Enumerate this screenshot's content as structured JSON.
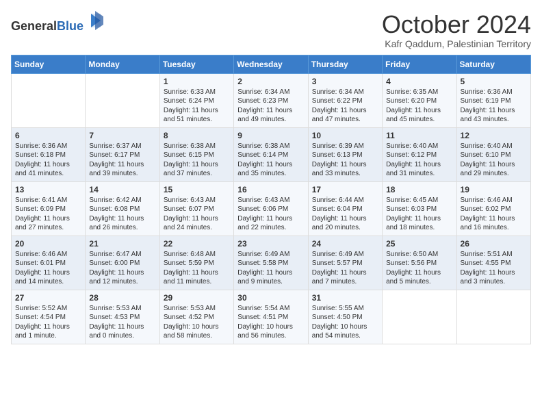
{
  "header": {
    "logo_general": "General",
    "logo_blue": "Blue",
    "month_title": "October 2024",
    "subtitle": "Kafr Qaddum, Palestinian Territory"
  },
  "days_of_week": [
    "Sunday",
    "Monday",
    "Tuesday",
    "Wednesday",
    "Thursday",
    "Friday",
    "Saturday"
  ],
  "weeks": [
    [
      {
        "day": "",
        "sunrise": "",
        "sunset": "",
        "daylight": ""
      },
      {
        "day": "",
        "sunrise": "",
        "sunset": "",
        "daylight": ""
      },
      {
        "day": "1",
        "sunrise": "Sunrise: 6:33 AM",
        "sunset": "Sunset: 6:24 PM",
        "daylight": "Daylight: 11 hours and 51 minutes."
      },
      {
        "day": "2",
        "sunrise": "Sunrise: 6:34 AM",
        "sunset": "Sunset: 6:23 PM",
        "daylight": "Daylight: 11 hours and 49 minutes."
      },
      {
        "day": "3",
        "sunrise": "Sunrise: 6:34 AM",
        "sunset": "Sunset: 6:22 PM",
        "daylight": "Daylight: 11 hours and 47 minutes."
      },
      {
        "day": "4",
        "sunrise": "Sunrise: 6:35 AM",
        "sunset": "Sunset: 6:20 PM",
        "daylight": "Daylight: 11 hours and 45 minutes."
      },
      {
        "day": "5",
        "sunrise": "Sunrise: 6:36 AM",
        "sunset": "Sunset: 6:19 PM",
        "daylight": "Daylight: 11 hours and 43 minutes."
      }
    ],
    [
      {
        "day": "6",
        "sunrise": "Sunrise: 6:36 AM",
        "sunset": "Sunset: 6:18 PM",
        "daylight": "Daylight: 11 hours and 41 minutes."
      },
      {
        "day": "7",
        "sunrise": "Sunrise: 6:37 AM",
        "sunset": "Sunset: 6:17 PM",
        "daylight": "Daylight: 11 hours and 39 minutes."
      },
      {
        "day": "8",
        "sunrise": "Sunrise: 6:38 AM",
        "sunset": "Sunset: 6:15 PM",
        "daylight": "Daylight: 11 hours and 37 minutes."
      },
      {
        "day": "9",
        "sunrise": "Sunrise: 6:38 AM",
        "sunset": "Sunset: 6:14 PM",
        "daylight": "Daylight: 11 hours and 35 minutes."
      },
      {
        "day": "10",
        "sunrise": "Sunrise: 6:39 AM",
        "sunset": "Sunset: 6:13 PM",
        "daylight": "Daylight: 11 hours and 33 minutes."
      },
      {
        "day": "11",
        "sunrise": "Sunrise: 6:40 AM",
        "sunset": "Sunset: 6:12 PM",
        "daylight": "Daylight: 11 hours and 31 minutes."
      },
      {
        "day": "12",
        "sunrise": "Sunrise: 6:40 AM",
        "sunset": "Sunset: 6:10 PM",
        "daylight": "Daylight: 11 hours and 29 minutes."
      }
    ],
    [
      {
        "day": "13",
        "sunrise": "Sunrise: 6:41 AM",
        "sunset": "Sunset: 6:09 PM",
        "daylight": "Daylight: 11 hours and 27 minutes."
      },
      {
        "day": "14",
        "sunrise": "Sunrise: 6:42 AM",
        "sunset": "Sunset: 6:08 PM",
        "daylight": "Daylight: 11 hours and 26 minutes."
      },
      {
        "day": "15",
        "sunrise": "Sunrise: 6:43 AM",
        "sunset": "Sunset: 6:07 PM",
        "daylight": "Daylight: 11 hours and 24 minutes."
      },
      {
        "day": "16",
        "sunrise": "Sunrise: 6:43 AM",
        "sunset": "Sunset: 6:06 PM",
        "daylight": "Daylight: 11 hours and 22 minutes."
      },
      {
        "day": "17",
        "sunrise": "Sunrise: 6:44 AM",
        "sunset": "Sunset: 6:04 PM",
        "daylight": "Daylight: 11 hours and 20 minutes."
      },
      {
        "day": "18",
        "sunrise": "Sunrise: 6:45 AM",
        "sunset": "Sunset: 6:03 PM",
        "daylight": "Daylight: 11 hours and 18 minutes."
      },
      {
        "day": "19",
        "sunrise": "Sunrise: 6:46 AM",
        "sunset": "Sunset: 6:02 PM",
        "daylight": "Daylight: 11 hours and 16 minutes."
      }
    ],
    [
      {
        "day": "20",
        "sunrise": "Sunrise: 6:46 AM",
        "sunset": "Sunset: 6:01 PM",
        "daylight": "Daylight: 11 hours and 14 minutes."
      },
      {
        "day": "21",
        "sunrise": "Sunrise: 6:47 AM",
        "sunset": "Sunset: 6:00 PM",
        "daylight": "Daylight: 11 hours and 12 minutes."
      },
      {
        "day": "22",
        "sunrise": "Sunrise: 6:48 AM",
        "sunset": "Sunset: 5:59 PM",
        "daylight": "Daylight: 11 hours and 11 minutes."
      },
      {
        "day": "23",
        "sunrise": "Sunrise: 6:49 AM",
        "sunset": "Sunset: 5:58 PM",
        "daylight": "Daylight: 11 hours and 9 minutes."
      },
      {
        "day": "24",
        "sunrise": "Sunrise: 6:49 AM",
        "sunset": "Sunset: 5:57 PM",
        "daylight": "Daylight: 11 hours and 7 minutes."
      },
      {
        "day": "25",
        "sunrise": "Sunrise: 6:50 AM",
        "sunset": "Sunset: 5:56 PM",
        "daylight": "Daylight: 11 hours and 5 minutes."
      },
      {
        "day": "26",
        "sunrise": "Sunrise: 5:51 AM",
        "sunset": "Sunset: 4:55 PM",
        "daylight": "Daylight: 11 hours and 3 minutes."
      }
    ],
    [
      {
        "day": "27",
        "sunrise": "Sunrise: 5:52 AM",
        "sunset": "Sunset: 4:54 PM",
        "daylight": "Daylight: 11 hours and 1 minute."
      },
      {
        "day": "28",
        "sunrise": "Sunrise: 5:53 AM",
        "sunset": "Sunset: 4:53 PM",
        "daylight": "Daylight: 11 hours and 0 minutes."
      },
      {
        "day": "29",
        "sunrise": "Sunrise: 5:53 AM",
        "sunset": "Sunset: 4:52 PM",
        "daylight": "Daylight: 10 hours and 58 minutes."
      },
      {
        "day": "30",
        "sunrise": "Sunrise: 5:54 AM",
        "sunset": "Sunset: 4:51 PM",
        "daylight": "Daylight: 10 hours and 56 minutes."
      },
      {
        "day": "31",
        "sunrise": "Sunrise: 5:55 AM",
        "sunset": "Sunset: 4:50 PM",
        "daylight": "Daylight: 10 hours and 54 minutes."
      },
      {
        "day": "",
        "sunrise": "",
        "sunset": "",
        "daylight": ""
      },
      {
        "day": "",
        "sunrise": "",
        "sunset": "",
        "daylight": ""
      }
    ]
  ]
}
